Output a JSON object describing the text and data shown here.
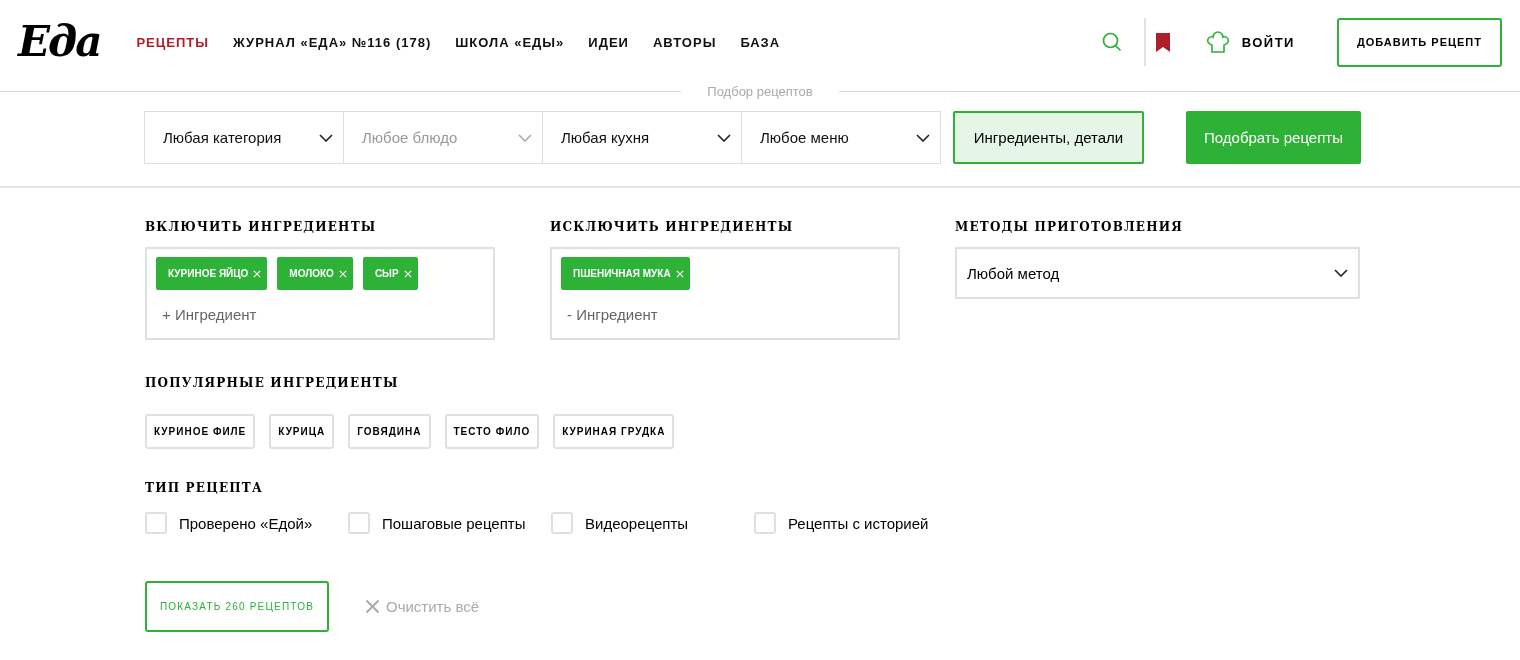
{
  "header": {
    "logo": "Еда",
    "nav": [
      {
        "label": "РЕЦЕПТЫ",
        "selected": true
      },
      {
        "label": "ЖУРНАЛ «ЕДА» №116 (178)",
        "selected": false
      },
      {
        "label": "ШКОЛА «ЕДЫ»",
        "selected": false
      },
      {
        "label": "ИДЕИ",
        "selected": false
      },
      {
        "label": "АВТОРЫ",
        "selected": false
      },
      {
        "label": "БАЗА",
        "selected": false
      }
    ],
    "login": "ВОЙТИ",
    "add_recipe": "ДОБАВИТЬ РЕЦЕПТ"
  },
  "search": {
    "title": "Подбор рецептов",
    "dropdowns": [
      {
        "value": "Любая категория",
        "disabled": false
      },
      {
        "value": "Любое блюдо",
        "disabled": true
      },
      {
        "value": "Любая кухня",
        "disabled": false
      },
      {
        "value": "Любое меню",
        "disabled": false
      }
    ],
    "details_button": {
      "label": "Ингредиенты, детали",
      "active": true
    },
    "submit": "Подобрать рецепты"
  },
  "include": {
    "title": "ВКЛЮЧИТЬ ИНГРЕДИЕНТЫ",
    "tags": [
      "КУРИНОЕ ЯЙЦО",
      "МОЛОКО",
      "СЫР"
    ],
    "placeholder": "+ Ингредиент"
  },
  "exclude": {
    "title": "ИСКЛЮЧИТЬ ИНГРЕДИЕНТЫ",
    "tags": [
      "ПШЕНИЧНАЯ МУКА"
    ],
    "placeholder": "- Ингредиент"
  },
  "methods": {
    "title": "МЕТОДЫ ПРИГОТОВЛЕНИЯ",
    "value": "Любой метод"
  },
  "popular": {
    "title": "ПОПУЛЯРНЫЕ ИНГРЕДИЕНТЫ",
    "items": [
      "КУРИНОЕ ФИЛЕ",
      "КУРИЦА",
      "ГОВЯДИНА",
      "ТЕСТО ФИЛО",
      "КУРИНАЯ ГРУДКА"
    ]
  },
  "recipe_type": {
    "title": "ТИП РЕЦЕПТА",
    "options": [
      {
        "label": "Проверено «Едой»",
        "checked": false
      },
      {
        "label": "Пошаговые рецепты",
        "checked": false
      },
      {
        "label": "Видеорецепты",
        "checked": false
      },
      {
        "label": "Рецепты с историей",
        "checked": false
      }
    ]
  },
  "show_button": "ПОКАЗАТЬ 260 РЕЦЕПТОВ",
  "clear": "Очистить всё"
}
